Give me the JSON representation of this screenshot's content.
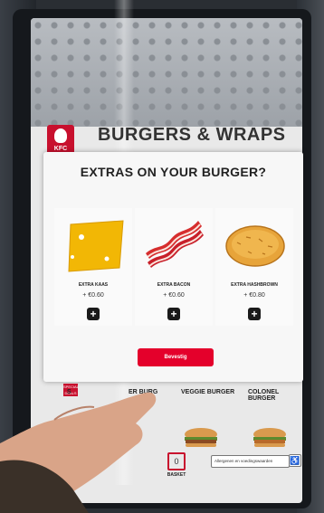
{
  "category": {
    "title": "BURGERS & WRAPS"
  },
  "brand": {
    "logo_text": "KFC"
  },
  "modal": {
    "title": "EXTRAS ON YOUR BURGER?",
    "items": [
      {
        "name": "EXTRA KAAS",
        "price": "+ €0.60",
        "icon": "cheese-slice"
      },
      {
        "name": "EXTRA BACON",
        "price": "+ €0.60",
        "icon": "bacon-strips"
      },
      {
        "name": "EXTRA HASHBROWN",
        "price": "+ €0.80",
        "icon": "hashbrown"
      }
    ],
    "add_label": "+",
    "confirm_label": "Bevestig"
  },
  "menu_tabs": {
    "items": [
      "S",
      "ER BURG",
      "VEGGIE BURGER",
      "COLONEL BURGER"
    ],
    "tab_icon_text": "SPECIAL DEALS"
  },
  "footer": {
    "basket_count": "0",
    "basket_label": "BASKET",
    "allergen_label": "Allergenen en voedingswaarden",
    "accessibility_icon": "wheelchair-icon"
  },
  "colors": {
    "brand_red": "#e4002b",
    "cheese": "#f2b705",
    "bacon": "#c8202a"
  }
}
